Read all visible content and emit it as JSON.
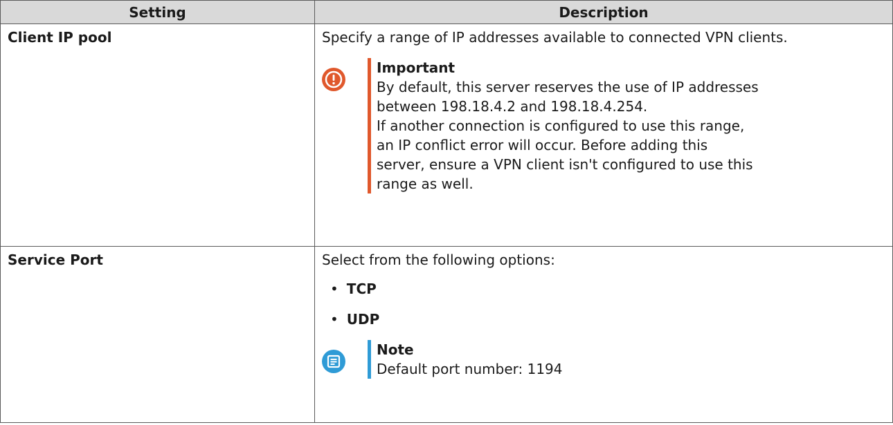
{
  "table": {
    "headers": [
      "Setting",
      "Description"
    ],
    "rows": [
      {
        "setting": "Client IP pool",
        "description": "Specify a range of IP addresses available to connected VPN clients.",
        "callout": {
          "kind": "important",
          "icon": "important-icon",
          "title": "Important",
          "text": "By default, this server reserves the use of IP addresses\nbetween 198.18.4.2 and 198.18.4.254.\nIf another connection is configured to use this range,\nan IP conflict error will occur. Before adding this\nserver, ensure a VPN client isn't configured to use this\nrange as well."
        }
      },
      {
        "setting": "Service Port",
        "description": "Select from the following options:",
        "options": [
          "TCP",
          "UDP"
        ],
        "callout": {
          "kind": "note",
          "icon": "note-icon",
          "title": "Note",
          "text": "Default port number: 1194"
        }
      }
    ]
  },
  "colors": {
    "header_bg": "#d9d9d9",
    "important": "#e0582c",
    "note": "#2f9bd6"
  }
}
